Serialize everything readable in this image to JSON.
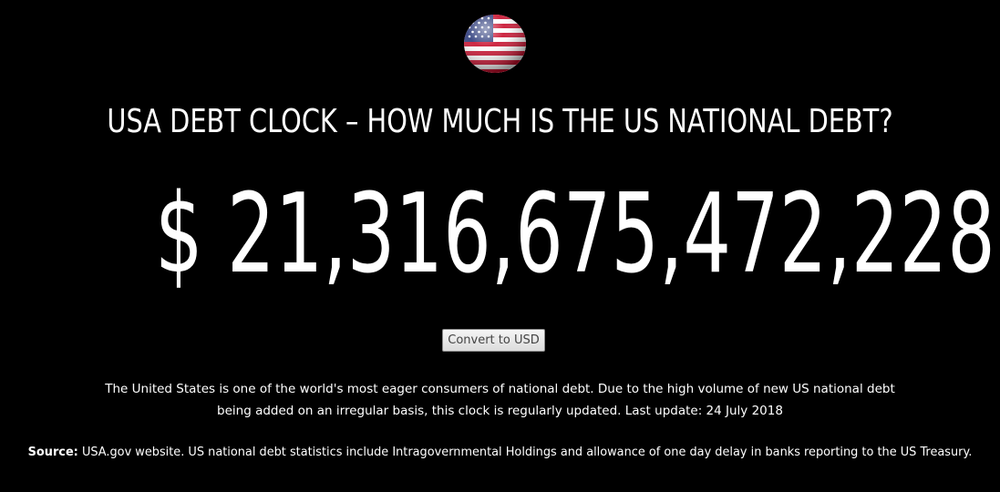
{
  "colors": {
    "background": "#000000",
    "text": "#ffffff",
    "button_text": "#444444"
  },
  "flag": {
    "icon": "us-flag-icon"
  },
  "header": {
    "title": "USA DEBT CLOCK – HOW MUCH IS THE US NATIONAL DEBT?"
  },
  "debt": {
    "display": "$ 21,316,675,472,228"
  },
  "convert_button": {
    "label": "Convert to USD"
  },
  "description": {
    "line1": "The United States is one of the world's most eager consumers of national debt. Due to the high volume of new US national debt",
    "line2": "being added on an irregular basis, this clock is regularly updated. Last update: 24 July 2018"
  },
  "source": {
    "label": "Source:",
    "text": " USA.gov website. US national debt statistics include Intragovernmental Holdings and allowance of one day delay in banks reporting to the US Treasury."
  }
}
